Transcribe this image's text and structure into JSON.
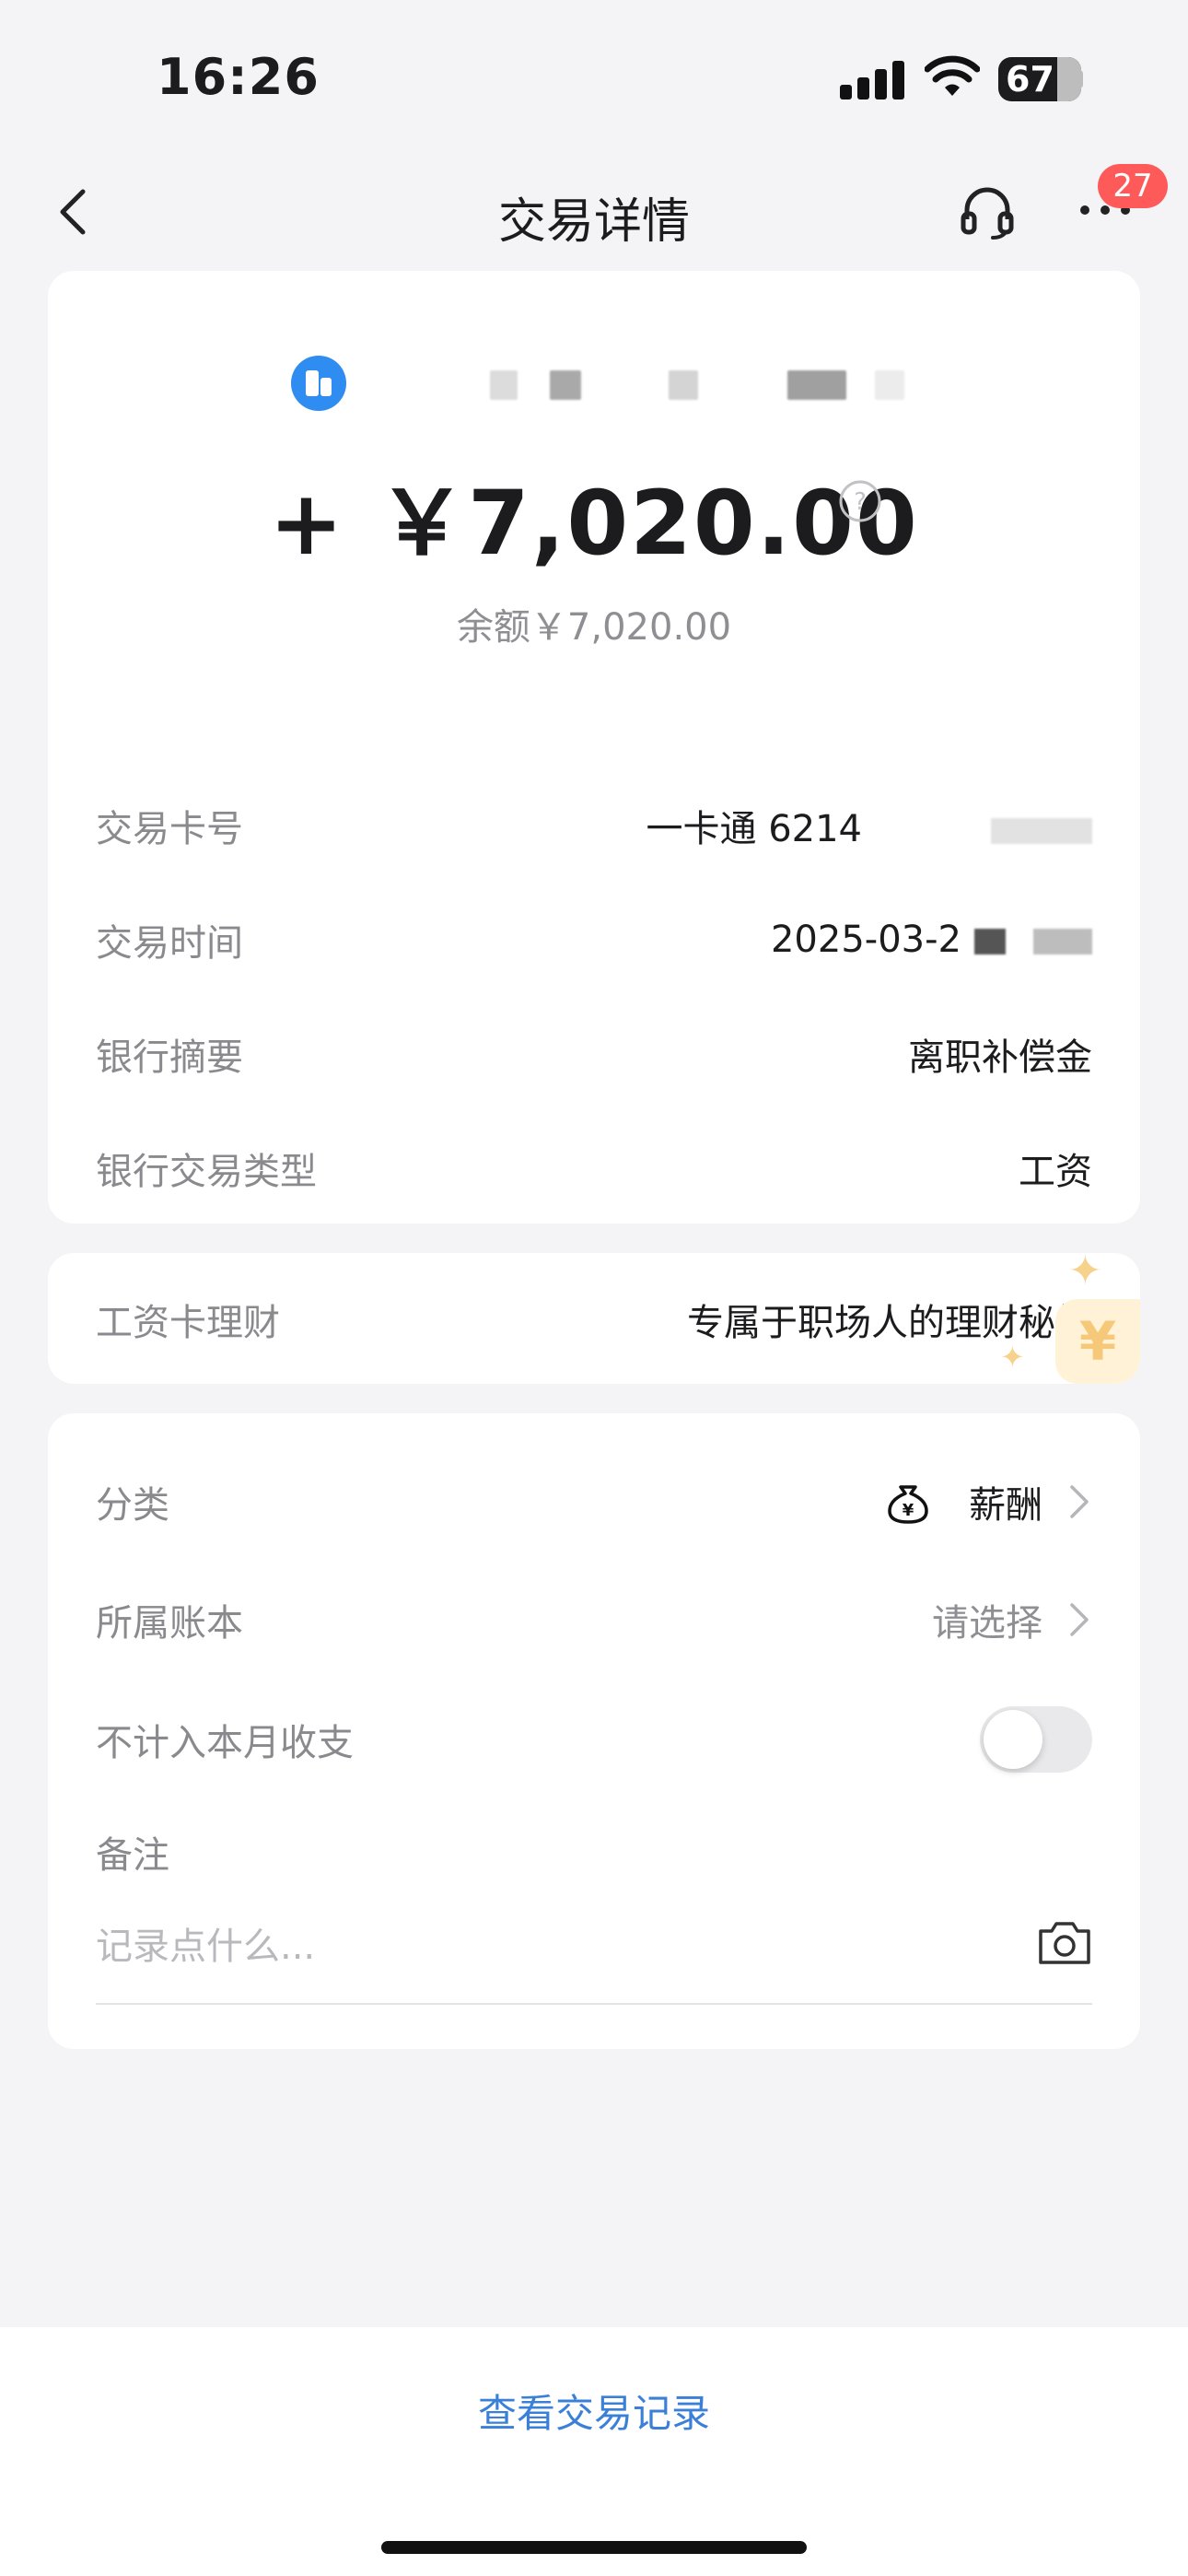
{
  "status_bar": {
    "time": "16:26",
    "battery": "67"
  },
  "nav": {
    "title": "交易详情",
    "badge_count": "27"
  },
  "transaction": {
    "amount": "+ ￥7,020.00",
    "balance": "余额￥7,020.00",
    "details": [
      {
        "label": "交易卡号",
        "value": "一卡通 6214"
      },
      {
        "label": "交易时间",
        "value": "2025-03-2"
      },
      {
        "label": "银行摘要",
        "value": "离职补偿金"
      },
      {
        "label": "银行交易类型",
        "value": "工资"
      }
    ]
  },
  "promo": {
    "label": "工资卡理财",
    "value": "专属于职场人的理财秘籍",
    "coin_symbol": "¥"
  },
  "settings": {
    "category": {
      "label": "分类",
      "value": "薪酬",
      "icon": "money-bag-icon"
    },
    "ledger": {
      "label": "所属账本",
      "value": "请选择"
    },
    "exclude": {
      "label": "不计入本月收支",
      "enabled": false
    },
    "note": {
      "label": "备注",
      "placeholder": "记录点什么..."
    }
  },
  "footer": {
    "link": "查看交易记录"
  },
  "colors": {
    "accent": "#3a7fd8",
    "badge": "#ff5a5a",
    "bank_icon": "#2f8cf0"
  }
}
